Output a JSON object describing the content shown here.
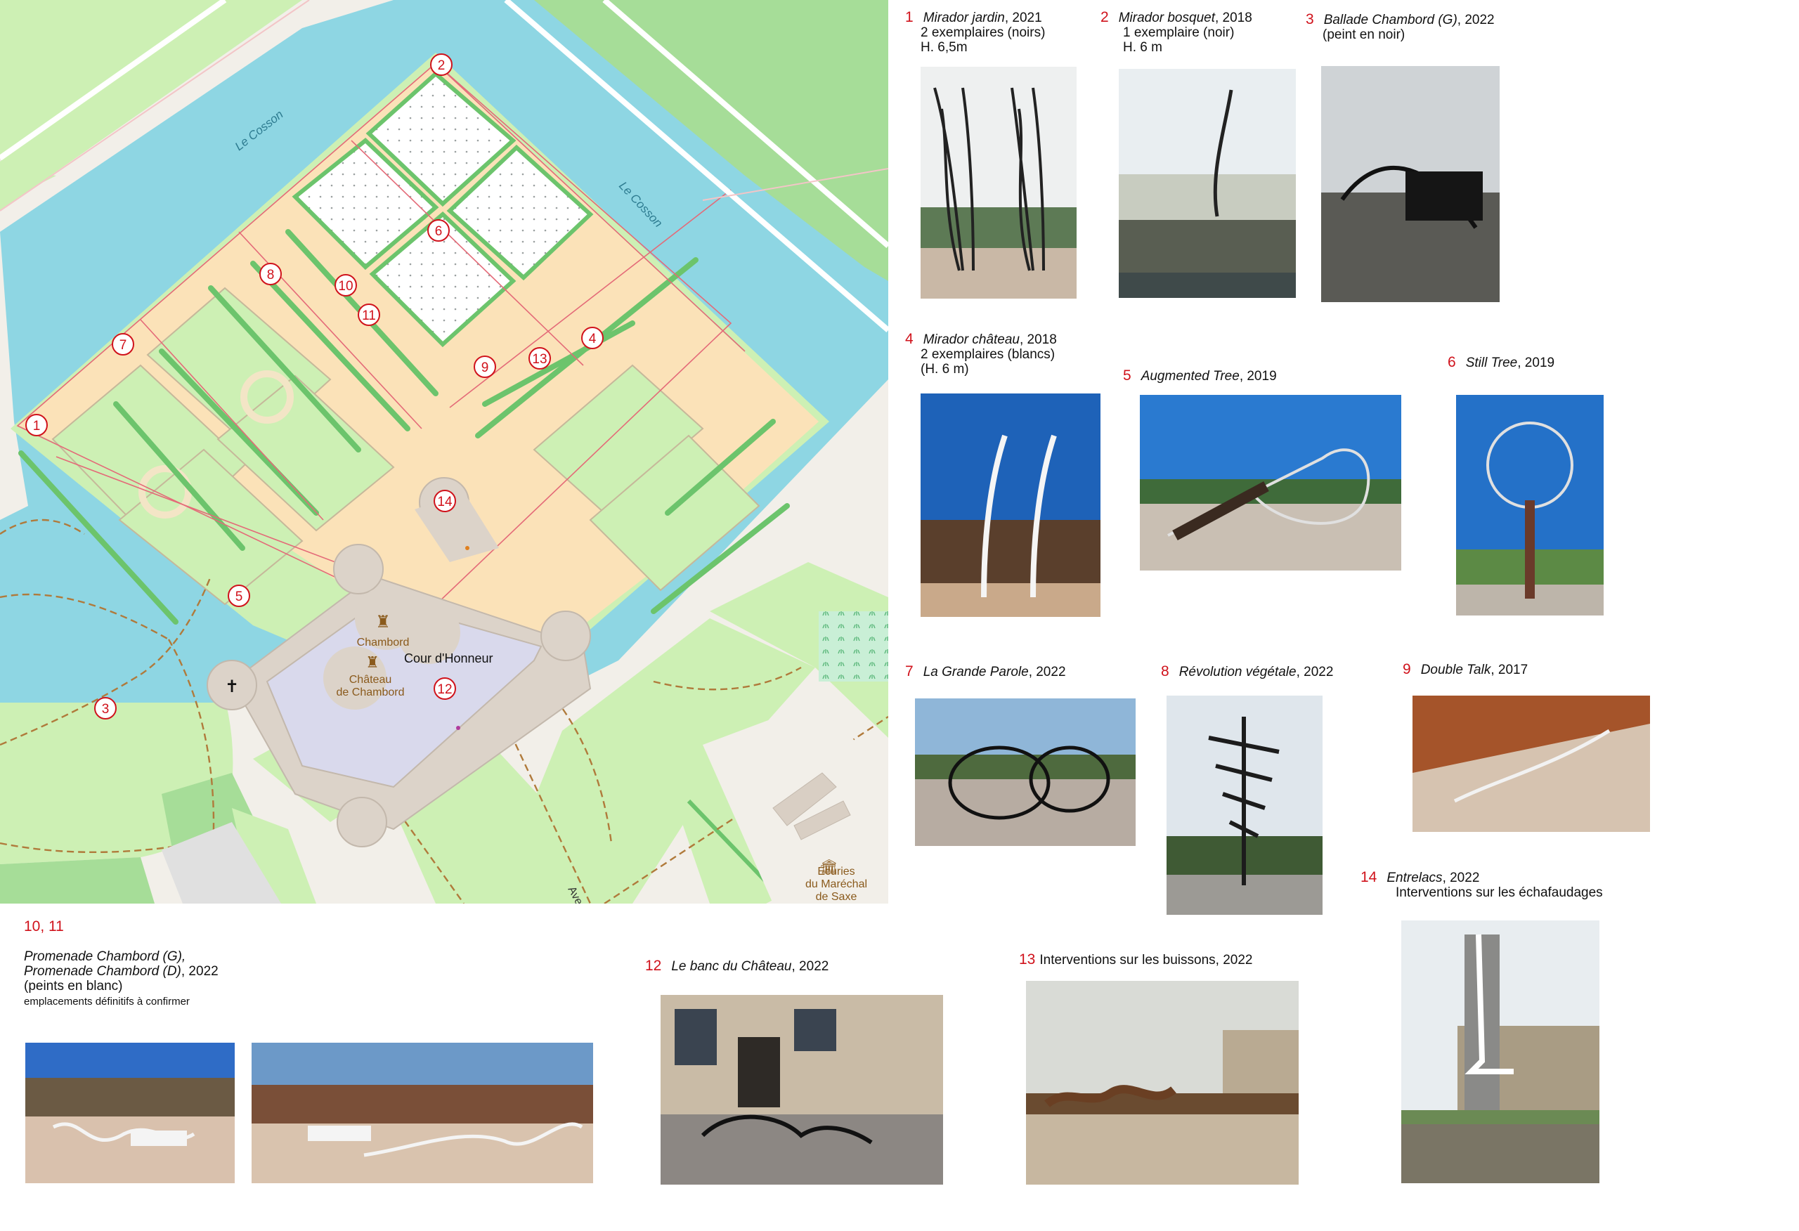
{
  "map": {
    "river_labels": [
      "Le Cosson",
      "Le Cosson"
    ],
    "chateau_label_1": "Chambord",
    "chateau_label_2a": "Château",
    "chateau_label_2b": "de Chambord",
    "court_label": "Cour d'Honneur",
    "stables_label_a": "Écuries",
    "stables_label_b": "du Maréchal",
    "stables_label_c": "de Saxe",
    "avenue_label": "Avenue",
    "markers": [
      "1",
      "2",
      "3",
      "4",
      "5",
      "6",
      "7",
      "8",
      "9",
      "10",
      "11",
      "12",
      "13",
      "14"
    ],
    "colors": {
      "water": "#8ed6e3",
      "garden": "#fbe2b8",
      "lawn": "#cdf0b4",
      "wood": "#a6dd98",
      "marker": "#d0121b",
      "building": "#dcd3c9",
      "courtyard": "#d9d9ec"
    }
  },
  "works": [
    {
      "num": "1",
      "title": "Mirador jardin",
      "year": ", 2021",
      "lines": [
        "2 exemplaires (noirs)",
        "H. 6,5m"
      ]
    },
    {
      "num": "2",
      "title": "Mirador bosquet",
      "year": ", 2018",
      "lines": [
        "1 exemplaire (noir)",
        "H. 6 m"
      ]
    },
    {
      "num": "3",
      "title": "Ballade Chambord (G)",
      "year": ", 2022",
      "lines": [
        "(peint en noir)"
      ]
    },
    {
      "num": "4",
      "title": "Mirador château",
      "year": ", 2018",
      "lines": [
        "2 exemplaires (blancs)",
        "(H. 6 m)"
      ]
    },
    {
      "num": "5",
      "title": "Augmented Tree",
      "year": ", 2019",
      "lines": []
    },
    {
      "num": "6",
      "title": "Still Tree",
      "year": ", 2019",
      "lines": []
    },
    {
      "num": "7",
      "title": "La Grande Parole",
      "year": ", 2022",
      "lines": []
    },
    {
      "num": "8",
      "title": "Révolution végétale",
      "year": ", 2022",
      "lines": []
    },
    {
      "num": "9",
      "title": "Double Talk",
      "year": ", 2017",
      "lines": []
    },
    {
      "num": "14",
      "title": "Entrelacs",
      "year": ", 2022",
      "lines": [
        "Interventions sur les échafaudages"
      ]
    },
    {
      "num": "12",
      "title": "Le banc du Château",
      "year": ", 2022",
      "lines": []
    },
    {
      "num": "13",
      "title": "",
      "year": "Interventions sur les buissons, 2022",
      "lines": []
    }
  ],
  "promenade": {
    "num": "10, 11",
    "title1": "Promenade Chambord (G),",
    "title2": "Promenade Chambord (D)",
    "year": ", 2022",
    "line1": "(peints en blanc)",
    "line2": "emplacements définitifs à confirmer"
  }
}
